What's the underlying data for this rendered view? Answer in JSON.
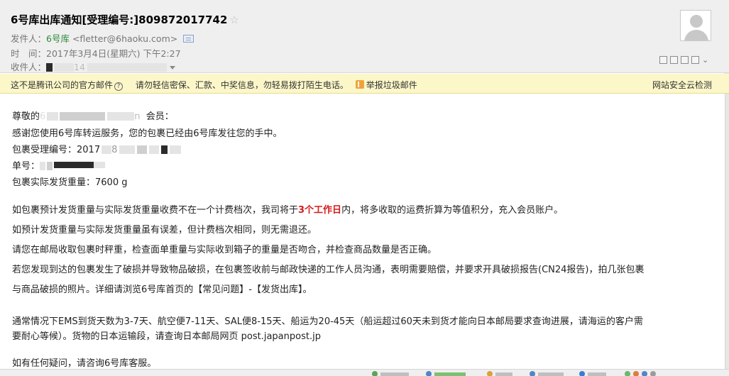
{
  "mail": {
    "subject": "6号库出库通知[受理编号:]809872017742",
    "star": "☆",
    "from_label": "发件人：",
    "from_name": "6号库",
    "from_email": "<fletter@6haoku.com>",
    "time_label": "时　间：",
    "time_value": "2017年3月4日(星期六) 下午2:27",
    "to_label": "收件人：",
    "to_partial": "14"
  },
  "notice": {
    "text1": "这不是腾讯公司的官方邮件",
    "help": "?",
    "text2": "请勿轻信密保、汇款、中奖信息，勿轻易拨打陌生电话。",
    "report": "举报垃圾邮件",
    "right": "网站安全云检测"
  },
  "body": {
    "greeting_pre": "尊敬的",
    "greeting_partial_1": "6",
    "greeting_partial_2": "n",
    "greeting_post": "会员：",
    "thanks": "感谢您使用6号库转运服务，您的包裹已经由6号库发往您的手中。",
    "pkg_no_label": "包裹受理编号：",
    "pkg_no_partial_1": "2017",
    "pkg_no_partial_2": "8",
    "tracking_label": "单号：",
    "weight": "包裹实际发货重量：7600 g",
    "para1_pre": "如包裹预计发货重量与实际发货重量收费不在一个计费档次，我司将于",
    "para1_red": "3个工作日",
    "para1_post": "内，将多收取的运费折算为等值积分，充入会员账户。",
    "para2": "如预计发货重量与实际发货重量虽有误差，但计费档次相同，则无需退还。",
    "para3": "请您在邮局收取包裹时秤重，检查面单重量与实际收到箱子的重量是否吻合，并检查商品数量是否正确。",
    "para4a": "若您发现到达的包裹发生了破损并导致物品破损，在包裹签收前与邮政快递的工作人员沟通，表明需要赔偿，并要求开具破损报告(CN24报告)，拍几张包裹",
    "para4b": "与商品破损的照片。详细请浏览6号库首页的【常见问题】-【发货出库】。",
    "para5a": "通常情况下EMS到货天数为3-7天、航空便7-11天、SAL便8-15天、船运为20-45天（船运超过60天未到货才能向日本邮局要求查询进展，请海运的客户需",
    "para5b": "要耐心等候）。货物的日本运输段，请查询日本邮局网页 post.japanpost.jp",
    "para6": "如有任何疑问，请咨询6号库客服。"
  },
  "colors": {
    "header_bg": "#efefef",
    "notice_bg": "#fcf7c9",
    "sender_green": "#2e8b3a",
    "highlight_red": "#d61a1a"
  },
  "icons": [
    "star-icon",
    "address-book-icon",
    "help-icon",
    "report-spam-icon",
    "avatar-icon",
    "window-tool-icons",
    "chevron-down-icon"
  ]
}
